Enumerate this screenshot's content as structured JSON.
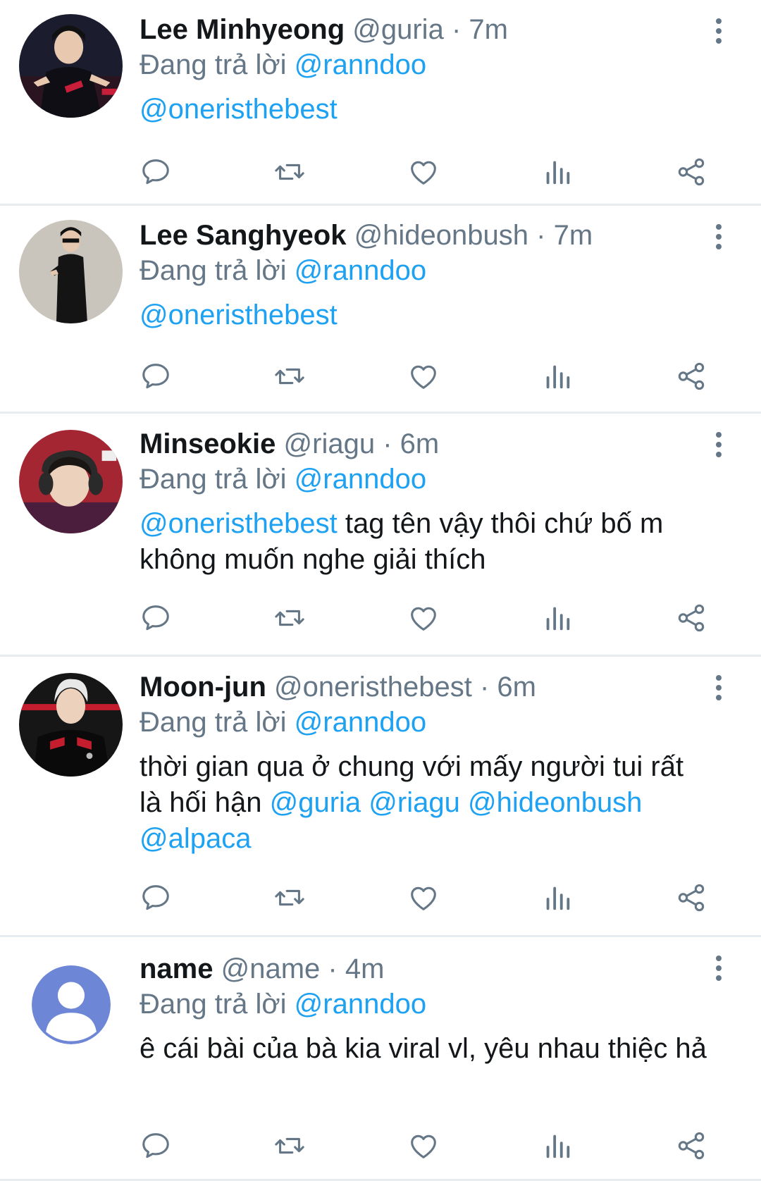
{
  "reply_prefix": "Đang trả lời",
  "colors": {
    "link": "#1da1f2",
    "secondary": "#657786",
    "divider": "#e6ecf0"
  },
  "icons": {
    "reply": "comment-icon",
    "retweet": "retweet-icon",
    "like": "heart-icon",
    "analytics": "analytics-icon",
    "share": "share-icon",
    "more": "vertical-dots-icon"
  },
  "tweets": [
    {
      "display_name": "Lee Minhyeong",
      "handle": "@guria",
      "separator": "·",
      "time": "7m",
      "reply_to": "@ranndoo",
      "body_mentions": [
        "@oneristhebest"
      ],
      "body_text": ""
    },
    {
      "display_name": "Lee Sanghyeok",
      "handle": "@hideonbush",
      "separator": "·",
      "time": "7m",
      "reply_to": "@ranndoo",
      "body_mentions": [
        "@oneristhebest"
      ],
      "body_text": ""
    },
    {
      "display_name": "Minseokie",
      "handle": "@riagu",
      "separator": "·",
      "time": "6m",
      "reply_to": "@ranndoo",
      "body_lead_mention": "@oneristhebest",
      "body_text": " tag tên vậy thôi chứ bố m không muốn nghe giải thích"
    },
    {
      "display_name": "Moon-jun",
      "handle": "@oneristhebest",
      "separator": "·",
      "time": "6m",
      "reply_to": "@ranndoo",
      "body_text": "thời gian qua ở chung với mấy người tui rất là hối hận ",
      "body_tail_mentions": [
        "@guria",
        "@riagu",
        "@hideonbush",
        "@alpaca"
      ]
    },
    {
      "display_name": "name",
      "handle": "@name",
      "separator": "·",
      "time": "4m",
      "reply_to": "@ranndoo",
      "body_text": "ê cái bài của bà kia viral vl, yêu nhau thiệc hả"
    }
  ]
}
